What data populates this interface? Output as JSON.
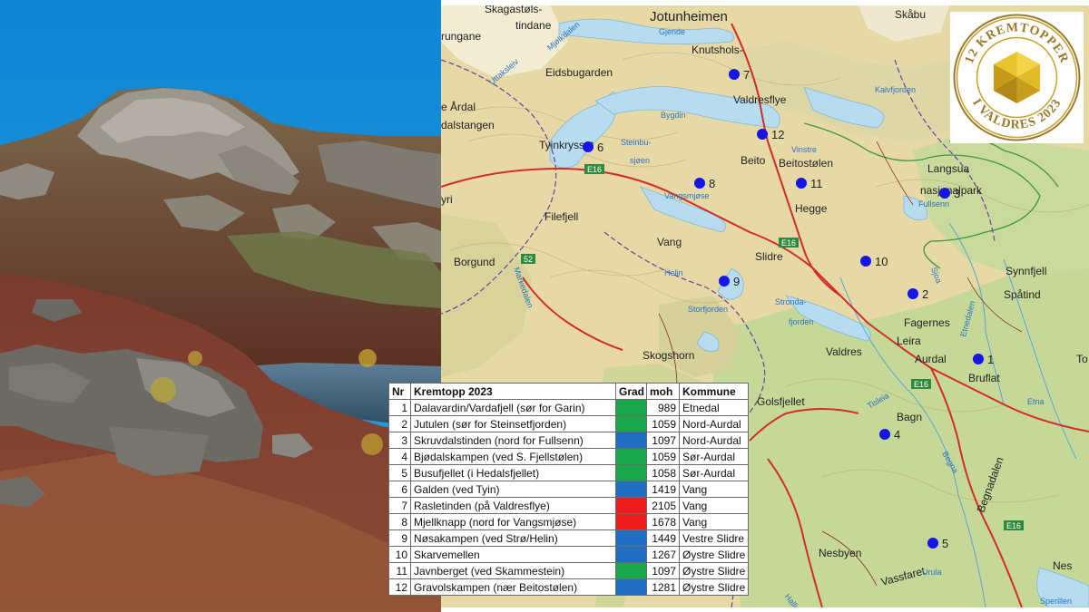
{
  "badge": {
    "top_text": "12 KREMTOPPER",
    "bottom_text": "I VALDRES 2023"
  },
  "map": {
    "places": [
      {
        "id": "jotunheimen",
        "label": "Jotunheimen"
      },
      {
        "id": "skagastols",
        "label": "Skagastøls-"
      },
      {
        "id": "tindane",
        "label": "tindane"
      },
      {
        "id": "skabu",
        "label": "Skåbu"
      },
      {
        "id": "rungane",
        "label": "rungane"
      },
      {
        "id": "knutsholstind",
        "label": "Knutshols-"
      },
      {
        "id": "eidsbugarden",
        "label": "Eidsbugarden"
      },
      {
        "id": "valdresflye",
        "label": "Valdresflye"
      },
      {
        "id": "lardal",
        "label": "e Årdal"
      },
      {
        "id": "dalstangen",
        "label": "dalstangen"
      },
      {
        "id": "tyinkrysset",
        "label": "Tyinkrysset"
      },
      {
        "id": "beito",
        "label": "Beito"
      },
      {
        "id": "beitostolen",
        "label": "Beitostølen"
      },
      {
        "id": "langsua",
        "label": "Langsua"
      },
      {
        "id": "nasjonalpark",
        "label": "nasjonalpark"
      },
      {
        "id": "filefjell",
        "label": "Filefjell"
      },
      {
        "id": "hegge",
        "label": "Hegge"
      },
      {
        "id": "vang",
        "label": "Vang"
      },
      {
        "id": "borgund",
        "label": "Borgund"
      },
      {
        "id": "slidre",
        "label": "Slidre"
      },
      {
        "id": "synnfjell",
        "label": "Synnfjell"
      },
      {
        "id": "spatind",
        "label": "Spåtind"
      },
      {
        "id": "fagernes",
        "label": "Fagernes"
      },
      {
        "id": "leira",
        "label": "Leira"
      },
      {
        "id": "valdres",
        "label": "Valdres"
      },
      {
        "id": "aurdal",
        "label": "Aurdal"
      },
      {
        "id": "bruflat",
        "label": "Bruflat"
      },
      {
        "id": "skogshorn",
        "label": "Skogshorn"
      },
      {
        "id": "golsfjellet",
        "label": "Golsfjellet"
      },
      {
        "id": "bagn",
        "label": "Bagn"
      },
      {
        "id": "begnadalen",
        "label": "Begnadalen"
      },
      {
        "id": "nesbyen",
        "label": "Nesbyen"
      },
      {
        "id": "nes",
        "label": "Nes"
      },
      {
        "id": "hallingdal",
        "label": "Halli"
      },
      {
        "id": "vassfaret",
        "label": "Vassfaret"
      },
      {
        "id": "yri",
        "label": "yri"
      },
      {
        "id": "to",
        "label": "To"
      }
    ],
    "waters": [
      {
        "id": "gjende",
        "label": "Gjende"
      },
      {
        "id": "bygdin",
        "label": "Bygdin"
      },
      {
        "id": "kalvfjorden",
        "label": "Kalvfjorden"
      },
      {
        "id": "vinstre",
        "label": "Vinstre"
      },
      {
        "id": "steinbusjoen",
        "label": "Steinbu-"
      },
      {
        "id": "sjoen",
        "label": "sjøen"
      },
      {
        "id": "vangsmjose",
        "label": "Vangsmjøse"
      },
      {
        "id": "fullsenn",
        "label": "Fullsenn"
      },
      {
        "id": "helin",
        "label": "Helin"
      },
      {
        "id": "strondafjorden",
        "label": "Stronda-"
      },
      {
        "id": "fjorden",
        "label": "fjorden"
      },
      {
        "id": "storfjorden",
        "label": "Storfjorden"
      },
      {
        "id": "tisleia",
        "label": "Tisleia"
      },
      {
        "id": "etna",
        "label": "Etna"
      },
      {
        "id": "begna",
        "label": "Begna"
      },
      {
        "id": "urula",
        "label": "Urula"
      },
      {
        "id": "sperillen",
        "label": "Sperillen"
      },
      {
        "id": "etnedalen",
        "label": "Etnedalen"
      },
      {
        "id": "mjolkdalen",
        "label": "Mjølkdalen"
      },
      {
        "id": "sjodalen",
        "label": "Sjoa"
      },
      {
        "id": "uttakleiv",
        "label": "Uttaksleiv"
      },
      {
        "id": "markedalen",
        "label": "Markedalen"
      }
    ],
    "roads": [
      {
        "id": "e16a",
        "label": "E16"
      },
      {
        "id": "e16b",
        "label": "E16"
      },
      {
        "id": "e16c",
        "label": "E16"
      },
      {
        "id": "e16d",
        "label": "E16"
      },
      {
        "id": "r52",
        "label": "52"
      }
    ],
    "peak_markers": [
      {
        "nr": "1"
      },
      {
        "nr": "2"
      },
      {
        "nr": "3"
      },
      {
        "nr": "4"
      },
      {
        "nr": "5"
      },
      {
        "nr": "6"
      },
      {
        "nr": "7"
      },
      {
        "nr": "8"
      },
      {
        "nr": "9"
      },
      {
        "nr": "10"
      },
      {
        "nr": "11"
      },
      {
        "nr": "12"
      }
    ]
  },
  "table": {
    "headers": [
      "Nr",
      "Kremtopp 2023",
      "Grad",
      "moh",
      "Kommune"
    ],
    "rows": [
      {
        "nr": "1",
        "name": "Dalavardin/Vardafjell (sør for Garin)",
        "grad": "#1aa64b",
        "moh": "989",
        "kommune": "Etnedal"
      },
      {
        "nr": "2",
        "name": "Jutulen (sør for Steinsetfjorden)",
        "grad": "#1aa64b",
        "moh": "1059",
        "kommune": "Nord-Aurdal"
      },
      {
        "nr": "3",
        "name": "Skruvdalstinden (nord for Fullsenn)",
        "grad": "#1f6ec2",
        "moh": "1097",
        "kommune": "Nord-Aurdal"
      },
      {
        "nr": "4",
        "name": "Bjødalskampen (ved S. Fjellstølen)",
        "grad": "#1aa64b",
        "moh": "1059",
        "kommune": "Sør-Aurdal"
      },
      {
        "nr": "5",
        "name": "Busufjellet (i Hedalsfjellet)",
        "grad": "#1aa64b",
        "moh": "1058",
        "kommune": "Sør-Aurdal"
      },
      {
        "nr": "6",
        "name": "Galden (ved Tyin)",
        "grad": "#1f6ec2",
        "moh": "1419",
        "kommune": "Vang"
      },
      {
        "nr": "7",
        "name": "Rasletinden (på Valdresflye)",
        "grad": "#ee1c1c",
        "moh": "2105",
        "kommune": "Vang"
      },
      {
        "nr": "8",
        "name": "Mjellknapp (nord for Vangsmjøse)",
        "grad": "#ee1c1c",
        "moh": "1678",
        "kommune": "Vang"
      },
      {
        "nr": "9",
        "name": "Nøsakampen (ved Strø/Helin)",
        "grad": "#1f6ec2",
        "moh": "1449",
        "kommune": "Vestre Slidre"
      },
      {
        "nr": "10",
        "name": "Skarvemellen",
        "grad": "#1f6ec2",
        "moh": "1267",
        "kommune": "Øystre Slidre"
      },
      {
        "nr": "11",
        "name": "Javnberget (ved Skammestein)",
        "grad": "#1aa64b",
        "moh": "1097",
        "kommune": "Øystre Slidre"
      },
      {
        "nr": "12",
        "name": "Gravolskampen (nær Beitostølen)",
        "grad": "#1f6ec2",
        "moh": "1281",
        "kommune": "Øystre Slidre"
      }
    ]
  },
  "colors": {
    "sky": "#1f95d8",
    "rock": "#8e8c84",
    "heather": "#7a3a2a",
    "lake": "#4a6e86",
    "map_land": "#e8dfb0",
    "map_forest": "#bcd48e",
    "map_water": "#b5dcef",
    "map_road": "#d42b2b",
    "marker": "#1515e8",
    "badge_gold": "#c8a02a",
    "badge_ring": "#9a7a2a"
  }
}
